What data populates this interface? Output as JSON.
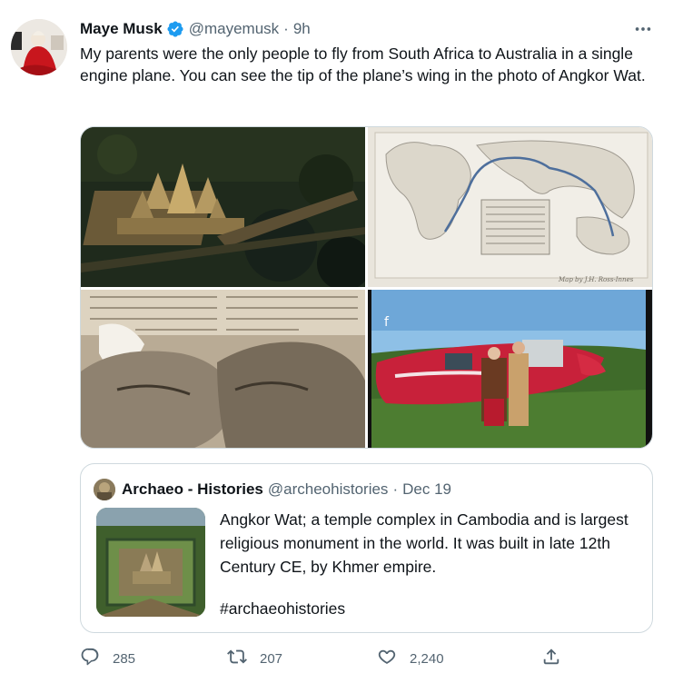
{
  "author": {
    "display_name": "Maye Musk",
    "handle": "@mayemusk",
    "separator": "·",
    "time": "9h",
    "verified": true
  },
  "more_icon": "more-horizontal-icon",
  "tweet": {
    "text": "My parents were the only people to fly from South Africa to Australia in a single engine plane. You can see the tip of the plane’s wing in the photo of Angkor Wat."
  },
  "media": {
    "photo_2_caption": "Map by J.H. Ross-Innes",
    "photo_3_clipping_text": "a tape at Delhi. Because we guard the plane during the night. ere South Africans they classi- We also saw the airport at Cal- d us as undesirable aliens and cutta crowded with refugees from our thumbprints. Indo-China.\""
  },
  "quoted_tweet": {
    "display_name": "Archaeo - Histories",
    "handle": "@archeohistories",
    "separator": "·",
    "time": "Dec 19",
    "text": "Angkor Wat; a temple complex in Cambodia and is largest religious monument in the world. It was built in late 12th Century CE, by Khmer empire.",
    "hashtag": "#archaeohistories"
  },
  "actions": {
    "reply_count": "285",
    "retweet_count": "207",
    "like_count": "2,240"
  },
  "colors": {
    "text": "#0f1419",
    "secondary": "#536471",
    "verified_blue": "#1d9bf0",
    "border": "#cfd9de"
  }
}
